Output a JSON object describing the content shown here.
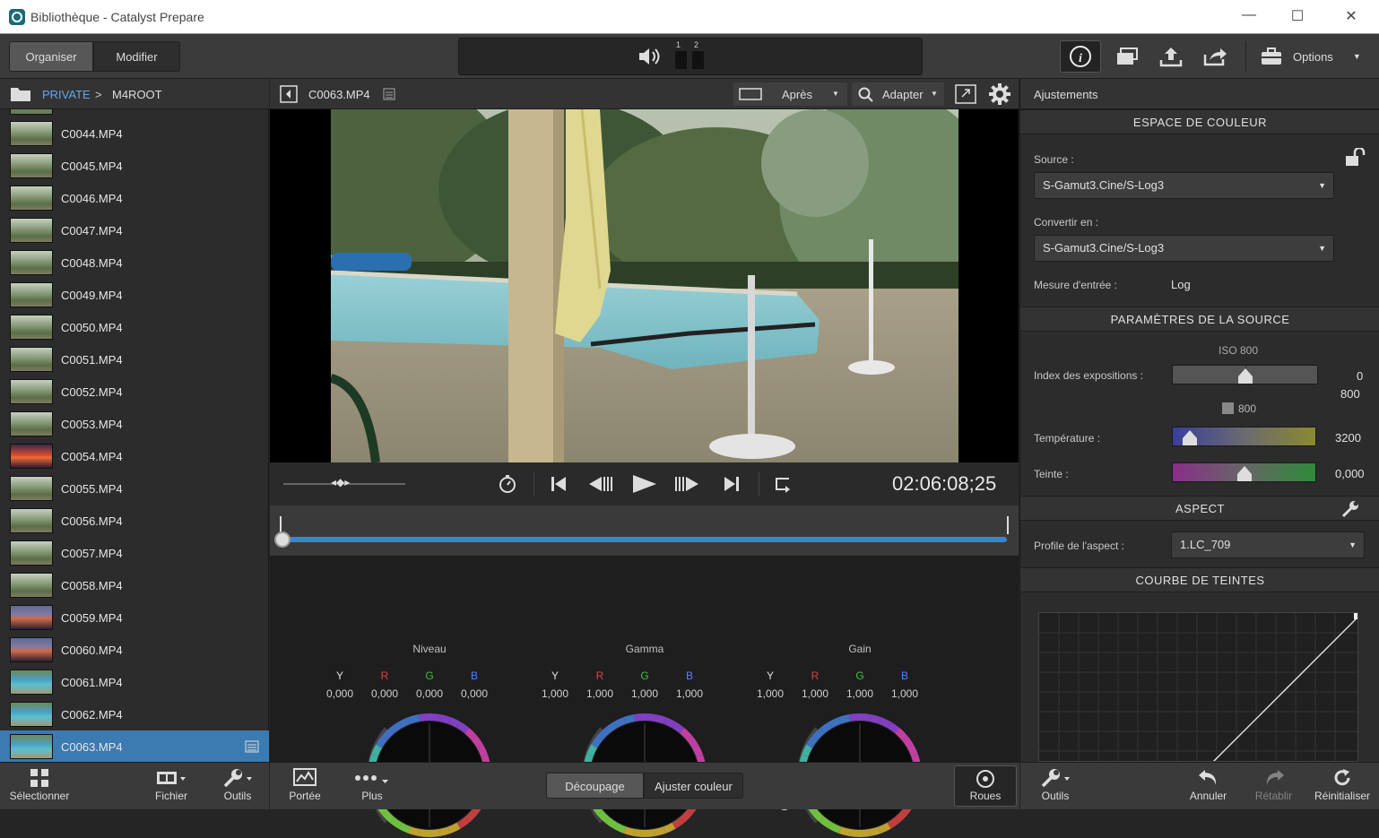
{
  "window": {
    "title": "Bibliothèque - Catalyst Prepare",
    "minimize": "—",
    "maximize": "☐",
    "close": "✕"
  },
  "topbar": {
    "tabs": [
      {
        "label": "Organiser",
        "active": true
      },
      {
        "label": "Modifier",
        "active": false
      }
    ],
    "audio_channels": [
      "1",
      "2"
    ],
    "options_label": "Options"
  },
  "breadcrumb": {
    "root": "PRIVATE",
    "separator": ">",
    "current": "M4ROOT"
  },
  "files": [
    {
      "name": "C0044.MP4",
      "thumb": "olive"
    },
    {
      "name": "C0045.MP4",
      "thumb": "olive"
    },
    {
      "name": "C0046.MP4",
      "thumb": "olive"
    },
    {
      "name": "C0047.MP4",
      "thumb": "olive"
    },
    {
      "name": "C0048.MP4",
      "thumb": "olive"
    },
    {
      "name": "C0049.MP4",
      "thumb": "olive"
    },
    {
      "name": "C0050.MP4",
      "thumb": "olive"
    },
    {
      "name": "C0051.MP4",
      "thumb": "olive"
    },
    {
      "name": "C0052.MP4",
      "thumb": "olive"
    },
    {
      "name": "C0053.MP4",
      "thumb": "olive"
    },
    {
      "name": "C0054.MP4",
      "thumb": "sunset"
    },
    {
      "name": "C0055.MP4",
      "thumb": "olive"
    },
    {
      "name": "C0056.MP4",
      "thumb": "olive"
    },
    {
      "name": "C0057.MP4",
      "thumb": "olive"
    },
    {
      "name": "C0058.MP4",
      "thumb": "olive"
    },
    {
      "name": "C0059.MP4",
      "thumb": "dusk"
    },
    {
      "name": "C0060.MP4",
      "thumb": "dusk"
    },
    {
      "name": "C0061.MP4",
      "thumb": "pool"
    },
    {
      "name": "C0062.MP4",
      "thumb": "pool"
    },
    {
      "name": "C0063.MP4",
      "thumb": "pool",
      "selected": true
    }
  ],
  "viewer": {
    "clip_name": "C0063.MP4",
    "compare_mode": "Après",
    "zoom_mode": "Adapter",
    "timecode": "02:06:08;25"
  },
  "wheels": [
    {
      "title": "Niveau",
      "values": {
        "Y": "0,000",
        "R": "0,000",
        "G": "0,000",
        "B": "0,000"
      }
    },
    {
      "title": "Gamma",
      "values": {
        "Y": "1,000",
        "R": "1,000",
        "G": "1,000",
        "B": "1,000"
      }
    },
    {
      "title": "Gain",
      "values": {
        "Y": "1,000",
        "R": "1,000",
        "G": "1,000",
        "B": "1,000"
      }
    }
  ],
  "channel_labels": [
    "Y",
    "R",
    "G",
    "B"
  ],
  "channel_colors": {
    "Y": "#e0e0e0",
    "R": "#e04040",
    "G": "#40c040",
    "B": "#5080ff"
  },
  "adjustments": {
    "header": "Ajustements",
    "color_space": {
      "title": "ESPACE DE COULEUR",
      "source_label": "Source :",
      "source_value": "S-Gamut3.Cine/S-Log3",
      "convert_label": "Convertir en :",
      "convert_value": "S-Gamut3.Cine/S-Log3",
      "metering_label": "Mesure d'entrée :",
      "metering_value": "Log"
    },
    "source_params": {
      "title": "PARAMÈTRES DE LA SOURCE",
      "iso": "ISO 800",
      "exposure_label": "Index des expositions :",
      "exposure_value": "0",
      "exposure_value2": "800",
      "exposure_sub": "800",
      "exposure_level": 0.5,
      "temperature_label": "Température :",
      "temperature_value": "3200",
      "temperature_level": 0.08,
      "tint_label": "Teinte :",
      "tint_value": "0,000",
      "tint_level": 0.5
    },
    "look": {
      "title": "ASPECT",
      "profile_label": "Profile de l'aspect :",
      "profile_value": "1.LC_709"
    },
    "curve": {
      "title": "COURBE DE TEINTES"
    }
  },
  "bottombar": {
    "left": [
      {
        "label": "Sélectionner",
        "icon": "grid-icon"
      },
      {
        "label": "Fichier",
        "icon": "film-icon"
      },
      {
        "label": "Outils",
        "icon": "wrench-icon"
      }
    ],
    "center_left": [
      {
        "label": "Portée",
        "icon": "scope-icon"
      },
      {
        "label": "Plus",
        "icon": "more-icon"
      }
    ],
    "mode_tabs": [
      {
        "label": "Découpage",
        "active": true
      },
      {
        "label": "Ajuster couleur",
        "active": false
      }
    ],
    "wheels_btn": "Roues",
    "right": [
      {
        "label": "Outils",
        "icon": "wrench-icon"
      },
      {
        "label": "Annuler",
        "icon": "undo-icon"
      },
      {
        "label": "Rétablir",
        "icon": "redo-icon"
      },
      {
        "label": "Réinitialiser",
        "icon": "reset-icon"
      }
    ]
  }
}
